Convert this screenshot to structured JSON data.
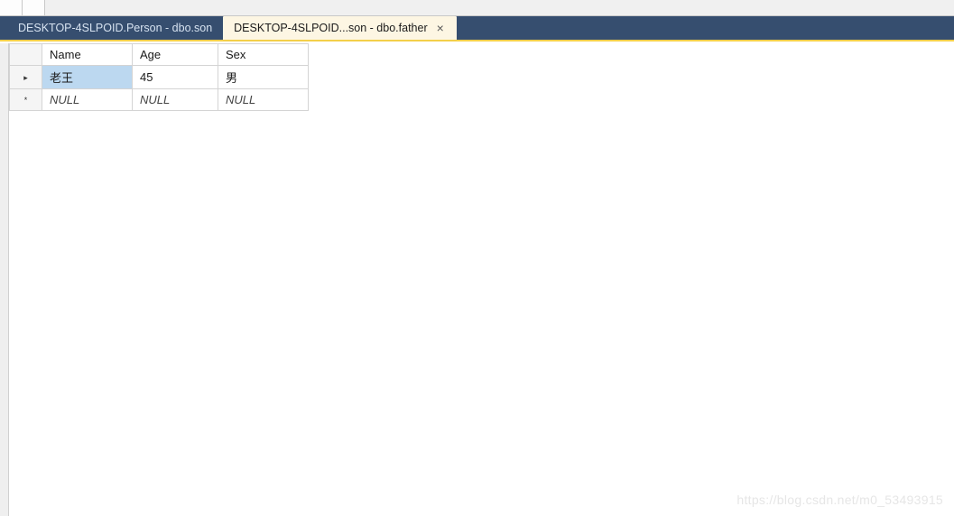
{
  "toolbar": {},
  "tabs": [
    {
      "label": "DESKTOP-4SLPOID.Person - dbo.son",
      "active": false,
      "closable": false
    },
    {
      "label": "DESKTOP-4SLPOID...son - dbo.father",
      "active": true,
      "closable": true
    }
  ],
  "grid": {
    "columns": [
      "Name",
      "Age",
      "Sex"
    ],
    "rows": [
      {
        "indicator": "▸",
        "cells": [
          "老王",
          "45",
          "男"
        ],
        "selected_col": 0,
        "is_null_row": false
      },
      {
        "indicator": "*",
        "cells": [
          "NULL",
          "NULL",
          "NULL"
        ],
        "selected_col": -1,
        "is_null_row": true
      }
    ]
  },
  "null_text": "NULL",
  "watermark": "https://blog.csdn.net/m0_53493915"
}
